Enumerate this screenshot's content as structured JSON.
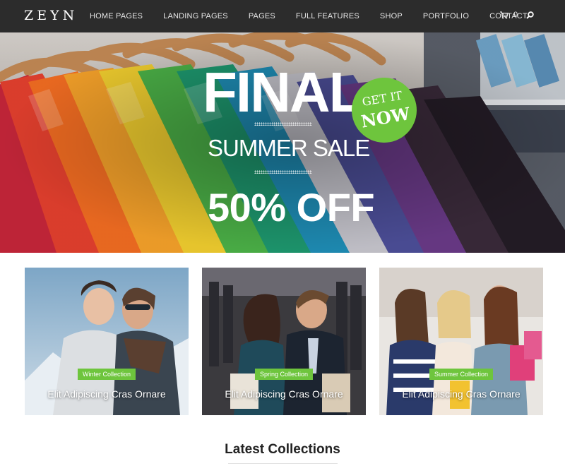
{
  "brand": {
    "logo": "ZEYN"
  },
  "nav": {
    "items": [
      {
        "label": "HOME PAGES"
      },
      {
        "label": "LANDING PAGES"
      },
      {
        "label": "PAGES"
      },
      {
        "label": "FULL FEATURES"
      },
      {
        "label": "SHOP"
      },
      {
        "label": "PORTFOLIO"
      },
      {
        "label": "CONTACT"
      }
    ],
    "cart_count": "0",
    "cart_icon": "cart-icon",
    "search_icon": "search-icon"
  },
  "hero": {
    "title": "FINAL",
    "subtitle": "SUMMER SALE",
    "discount": "50% OFF",
    "badge": {
      "line1": "GET IT",
      "line2": "NOW"
    },
    "badge_color": "#6ec53d"
  },
  "collections": [
    {
      "tag": "Winter Collection",
      "title": "Elit Adipiscing Cras Ornare"
    },
    {
      "tag": "Spring Collection",
      "title": "Elit Adipiscing Cras Ornare"
    },
    {
      "tag": "Summer Collection",
      "title": "Elit Adipiscing Cras Ornare"
    }
  ],
  "section": {
    "title": "Latest Collections"
  },
  "colors": {
    "nav_bg": "#2c2c2c",
    "accent": "#6ec53d",
    "text_dark": "#222222"
  }
}
